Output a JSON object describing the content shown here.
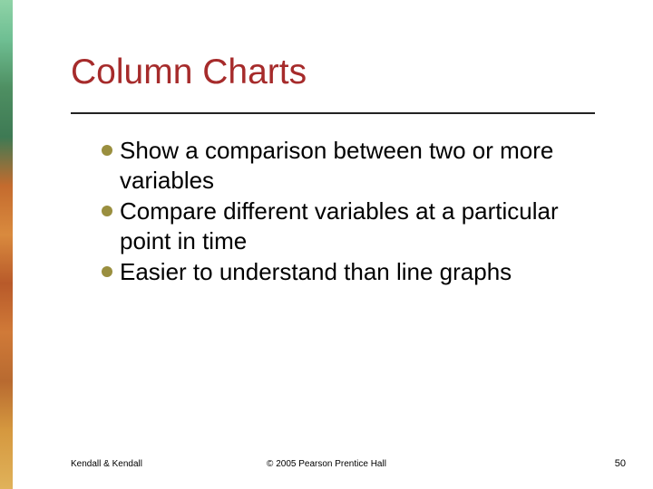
{
  "title": "Column Charts",
  "bullets": [
    "Show a comparison between two or more variables",
    "Compare different variables at a particular point in time",
    "Easier to understand than line graphs"
  ],
  "footer": {
    "left": "Kendall & Kendall",
    "center": "© 2005 Pearson Prentice Hall",
    "right": "50"
  },
  "colors": {
    "title_color": "#a62b2b",
    "bullet_color": "#9a8f3f"
  }
}
